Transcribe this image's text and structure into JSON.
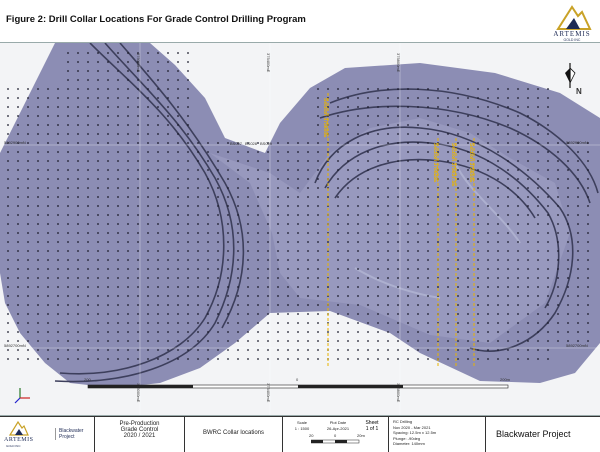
{
  "figure_title": "Figure 2: Drill Collar Locations For Grade Control Drilling Program",
  "logo": {
    "name": "ARTEMIS",
    "sub": "GOLD INC"
  },
  "map": {
    "north_arrow": "N",
    "easting_labels": [
      "375000mE",
      "375400mE",
      "375800mE"
    ],
    "northing_labels": [
      "5892900mN",
      "5892700mN"
    ],
    "section_labels": [
      "Section 375600E",
      "Section 375625E",
      "Section 375637.5E",
      "Section 375650E"
    ],
    "scale_labels": [
      "200",
      "0",
      "200m"
    ],
    "collar_labels_top": [
      "BS027",
      "BS028",
      "BS029"
    ]
  },
  "title_block": {
    "logo_name": "ARTEMIS",
    "logo_sub": "GOLD INC",
    "project_tag": "Blackwater Project",
    "pre_production": "Pre-Production",
    "grade_control": "Grade Control",
    "years": "2020 / 2021",
    "drawing_title": "BWRC Collar locations",
    "scale_label": "Scale",
    "scale_value": "1 : 1500",
    "plot_date_label": "Plot Date",
    "plot_date_value": "26-Apr-2021",
    "sheet_label": "Sheet",
    "sheet_value": "1 of 1",
    "scalebar_labels": [
      "20",
      "0",
      "20m"
    ],
    "notes": [
      "RC Drilling",
      "Nov 2020 - Mar 2021",
      "Spacing: 12.5m x 12.5m",
      "Plunge: -90deg",
      "Diameter: 140mm"
    ],
    "project_name": "Blackwater Project"
  }
}
